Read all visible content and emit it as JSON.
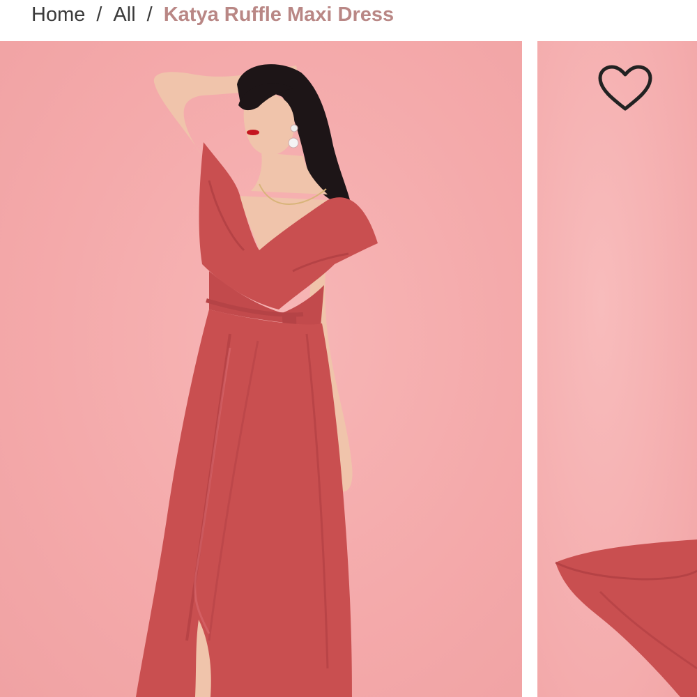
{
  "breadcrumb": {
    "items": [
      {
        "label": "Home"
      },
      {
        "label": "All"
      }
    ],
    "separator": "/",
    "current": "Katya Ruffle Maxi Dress"
  },
  "gallery": {
    "wishlist_icon": "heart-outline-icon"
  },
  "colors": {
    "background": "#f4a9aa",
    "dress": "#c94f50",
    "breadcrumb_current": "#b98785",
    "breadcrumb_text": "#3a3a3a"
  }
}
